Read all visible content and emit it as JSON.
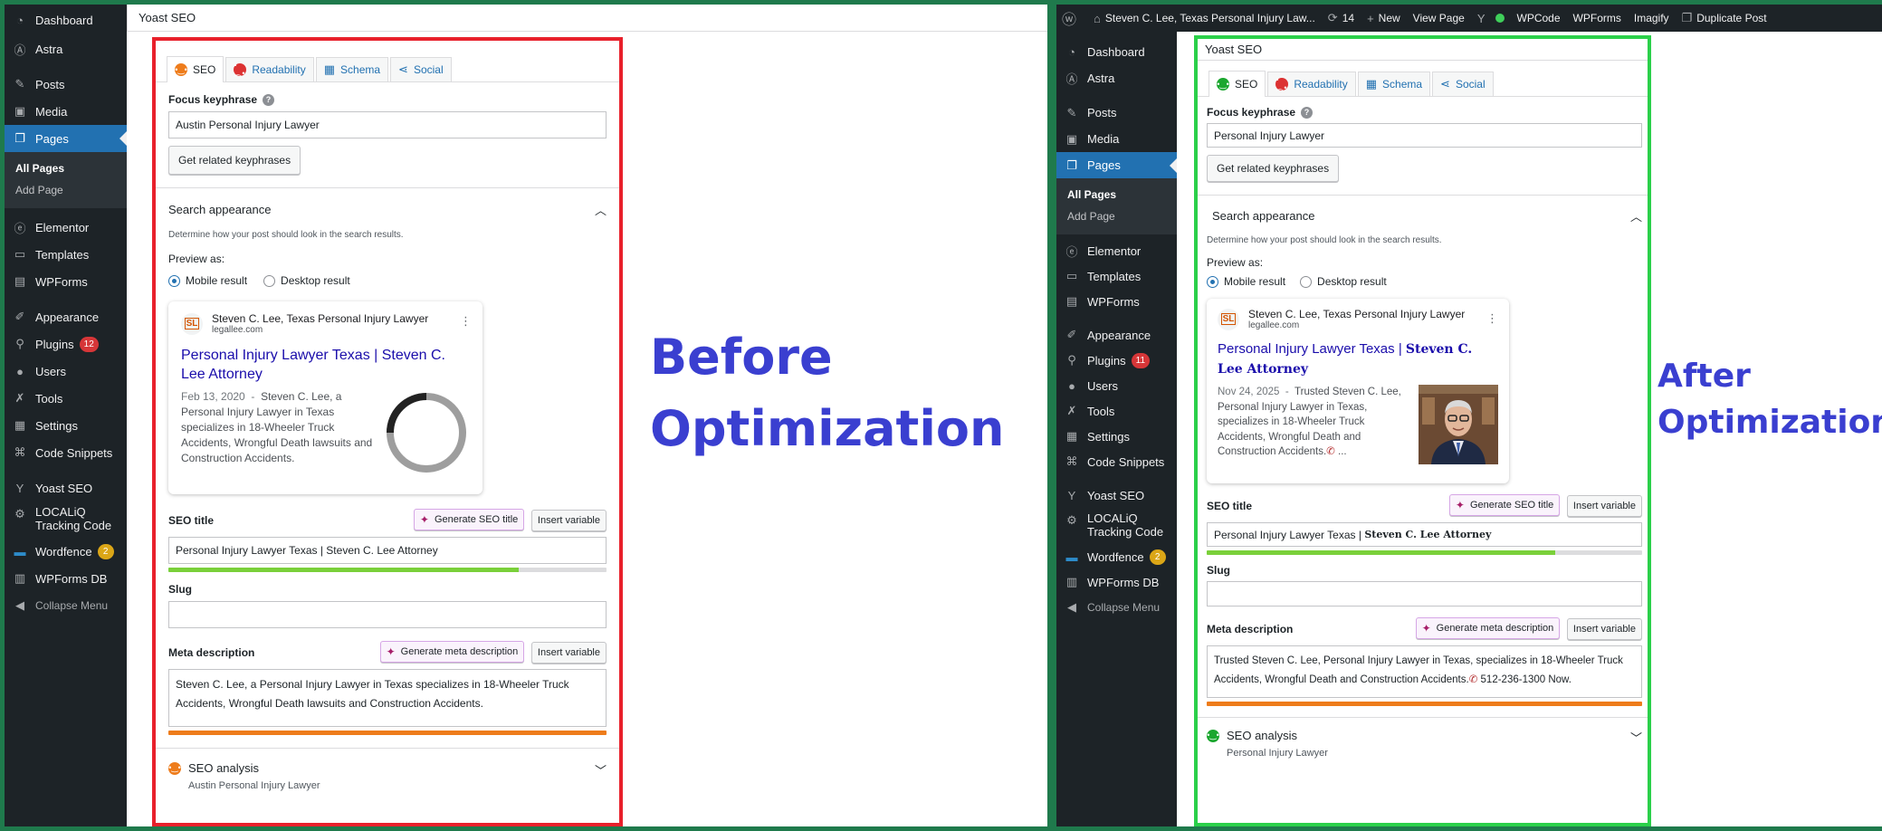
{
  "colors": {
    "frame_background": "#1f7a4c",
    "before_border": "#e8202b",
    "after_border": "#2bd04a",
    "label_color": "#3a3fd0",
    "wp_sidebar": "#1d2327",
    "wp_active": "#2271b1",
    "serp_link": "#1a0dab",
    "progress_green": "#7ad03a",
    "progress_orange": "#ee7c1b"
  },
  "before": {
    "label_line1": "Before",
    "label_line2": "Optimization",
    "sidebar": {
      "items": [
        "Dashboard",
        "Astra",
        "Posts",
        "Media",
        "Pages",
        "Elementor",
        "Templates",
        "WPForms",
        "Appearance",
        "Plugins",
        "Users",
        "Tools",
        "Settings",
        "Code Snippets",
        "Yoast SEO",
        "LOCALiQ Tracking Code",
        "Wordfence",
        "WPForms DB",
        "Collapse Menu"
      ],
      "submenu": [
        "All Pages",
        "Add Page"
      ],
      "plugins_badge": "12",
      "wordfence_badge": "2"
    },
    "yoast": {
      "header": "Yoast SEO",
      "tabs": [
        "SEO",
        "Readability",
        "Schema",
        "Social"
      ],
      "focus_keyphrase_label": "Focus keyphrase",
      "help": "?",
      "focus_keyphrase_value": "Austin Personal Injury Lawyer",
      "related_button": "Get related keyphrases",
      "search_appearance": "Search appearance",
      "search_appearance_desc": "Determine how your post should look in the search results.",
      "preview_as": "Preview as:",
      "mobile_result": "Mobile result",
      "desktop_result": "Desktop result",
      "serp": {
        "site_name": "Steven C. Lee, Texas Personal Injury Lawyer",
        "site_url": "legallee.com",
        "title": "Personal Injury Lawyer Texas | Steven C. Lee Attorney",
        "date": "Feb 13, 2020",
        "sep": "-",
        "description": "Steven C. Lee, a Personal Injury Lawyer in Texas specializes in 18-Wheeler Truck Accidents, Wrongful Death lawsuits and Construction Accidents."
      },
      "seo_title_label": "SEO title",
      "generate_seo_title": "Generate SEO title",
      "insert_variable": "Insert variable",
      "seo_title_value": "Personal Injury Lawyer Texas | Steven C. Lee Attorney",
      "seo_title_progress": 0.8,
      "slug_label": "Slug",
      "slug_value": "",
      "meta_label": "Meta description",
      "generate_meta": "Generate meta description",
      "meta_value": "Steven C. Lee, a Personal Injury Lawyer in Texas specializes in 18-Wheeler Truck Accidents, Wrongful Death lawsuits and Construction Accidents.",
      "meta_progress": 1.0,
      "analysis_title": "SEO analysis",
      "analysis_keyphrase": "Austin Personal Injury Lawyer"
    }
  },
  "after": {
    "label_line1": "After",
    "label_line2": "Optimization",
    "adminbar": {
      "site_title": "Steven C. Lee, Texas Personal Injury Law...",
      "updates": "14",
      "new": "New",
      "view_page": "View Page",
      "items": [
        "WPCode",
        "WPForms",
        "Imagify",
        "Duplicate Post"
      ]
    },
    "sidebar": {
      "items": [
        "Dashboard",
        "Astra",
        "Posts",
        "Media",
        "Pages",
        "Elementor",
        "Templates",
        "WPForms",
        "Appearance",
        "Plugins",
        "Users",
        "Tools",
        "Settings",
        "Code Snippets",
        "Yoast SEO",
        "LOCALiQ Tracking Code",
        "Wordfence",
        "WPForms DB",
        "Collapse Menu"
      ],
      "submenu": [
        "All Pages",
        "Add Page"
      ],
      "plugins_badge": "11",
      "wordfence_badge": "2"
    },
    "yoast": {
      "header": "Yoast SEO",
      "tabs": [
        "SEO",
        "Readability",
        "Schema",
        "Social"
      ],
      "focus_keyphrase_label": "Focus keyphrase",
      "help": "?",
      "focus_keyphrase_value": "Personal Injury Lawyer",
      "related_button": "Get related keyphrases",
      "search_appearance": "Search appearance",
      "search_appearance_desc": "Determine how your post should look in the search results.",
      "preview_as": "Preview as:",
      "mobile_result": "Mobile result",
      "desktop_result": "Desktop result",
      "serp": {
        "site_name": "Steven C. Lee, Texas Personal Injury Lawyer",
        "site_url": "legallee.com",
        "title_plain": "Personal Injury Lawyer Texas | ",
        "title_bold": "Steven C. Lee Attorney",
        "date": "Nov 24, 2025",
        "sep": "-",
        "description": "Trusted Steven C. Lee, Personal Injury Lawyer in Texas, specializes in 18-Wheeler Truck Accidents, Wrongful Death and Construction Accidents.",
        "ellipsis": " ..."
      },
      "seo_title_label": "SEO title",
      "generate_seo_title": "Generate SEO title",
      "insert_variable": "Insert variable",
      "seo_title_plain": "Personal Injury Lawyer Texas | ",
      "seo_title_bold": "Steven C. Lee Attorney",
      "seo_title_progress": 0.8,
      "slug_label": "Slug",
      "slug_value": "",
      "meta_label": "Meta description",
      "generate_meta": "Generate meta description",
      "meta_value": "Trusted Steven C. Lee, Personal Injury Lawyer in Texas, specializes in 18-Wheeler Truck Accidents, Wrongful Death and Construction Accidents.",
      "meta_phone": " 512-236-1300 Now.",
      "meta_progress": 1.0,
      "analysis_title": "SEO analysis",
      "analysis_keyphrase": "Personal Injury Lawyer"
    }
  }
}
